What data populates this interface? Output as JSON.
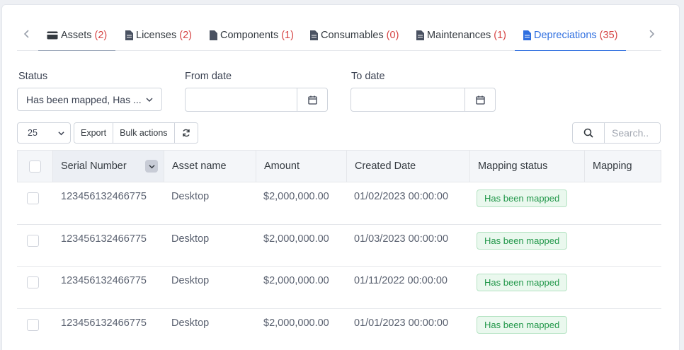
{
  "tabs": [
    {
      "label": "Assets",
      "count": "(2)",
      "icon": "credit-card-icon"
    },
    {
      "label": "Licenses",
      "count": "(2)",
      "icon": "file-icon"
    },
    {
      "label": "Components",
      "count": "(1)",
      "icon": "file-icon"
    },
    {
      "label": "Consumables",
      "count": "(0)",
      "icon": "file-icon"
    },
    {
      "label": "Maintenances",
      "count": "(1)",
      "icon": "file-icon"
    },
    {
      "label": "Depreciations",
      "count": "(35)",
      "icon": "file-icon"
    }
  ],
  "active_tab": "Depreciations",
  "filters": {
    "status_label": "Status",
    "status_value": "Has been mapped, Has ...",
    "from_label": "From date",
    "to_label": "To date"
  },
  "toolbar": {
    "page_size": "25",
    "export_label": "Export",
    "bulk_label": "Bulk actions",
    "search_placeholder": "Search.."
  },
  "table": {
    "columns": [
      "Serial Number",
      "Asset name",
      "Amount",
      "Created Date",
      "Mapping status",
      "Mapping"
    ],
    "rows": [
      {
        "serial": "123456132466775",
        "asset": "Desktop",
        "amount": "$2,000,000.00",
        "created": "01/02/2023 00:00:00",
        "status": "Has been mapped"
      },
      {
        "serial": "123456132466775",
        "asset": "Desktop",
        "amount": "$2,000,000.00",
        "created": "01/03/2023 00:00:00",
        "status": "Has been mapped"
      },
      {
        "serial": "123456132466775",
        "asset": "Desktop",
        "amount": "$2,000,000.00",
        "created": "01/11/2022 00:00:00",
        "status": "Has been mapped"
      },
      {
        "serial": "123456132466775",
        "asset": "Desktop",
        "amount": "$2,000,000.00",
        "created": "01/01/2023 00:00:00",
        "status": "Has been mapped"
      }
    ]
  },
  "colors": {
    "accent": "#2f6fe0",
    "count_red": "#d64545",
    "badge_green": "#23984b"
  }
}
